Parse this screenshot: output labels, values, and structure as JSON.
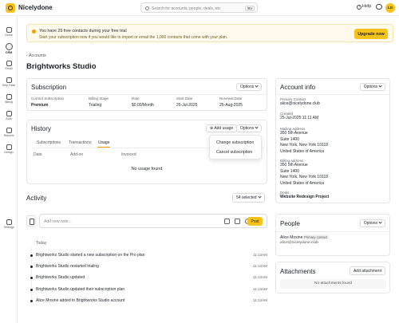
{
  "topbar": {
    "brand": "Nicelydone",
    "search_placeholder": "Search for accounts, people, deals, etc",
    "search_shortcut": "⌘K",
    "help_label": "Help",
    "avatar_initials": "LG"
  },
  "nav": [
    {
      "label": "Home",
      "icon": "home-icon"
    },
    {
      "label": "CRM",
      "icon": "crm-icon",
      "active": true
    },
    {
      "label": "Email",
      "icon": "email-icon"
    },
    {
      "label": "Help Desk",
      "icon": "help-desk-icon"
    },
    {
      "label": "Billing",
      "icon": "billing-icon"
    },
    {
      "label": "Auth",
      "icon": "auth-icon"
    },
    {
      "label": "Reports",
      "icon": "reports-icon"
    },
    {
      "label": "Design",
      "icon": "design-icon"
    },
    {
      "label": "Settings",
      "icon": "settings-icon"
    }
  ],
  "banner": {
    "title": "You have 25 free contacts during your free trial",
    "subtitle": "Start your subscription now if you would like to import or email the 1,000 contacts that come with your plan.",
    "cta": "Upgrade now"
  },
  "breadcrumb": "Accounts",
  "page_title": "Brightworks Studio",
  "subscription": {
    "title": "Subscription",
    "options_label": "Options",
    "fields": [
      {
        "label": "Current Subscription",
        "value": "Premium",
        "bold": true
      },
      {
        "label": "Billing Stage",
        "value": "Trialing"
      },
      {
        "label": "Rate",
        "value": "$0.00/Month"
      },
      {
        "label": "Start Date",
        "value": "25-Jul-2025"
      },
      {
        "label": "Renewal Date",
        "value": "25-Aug-2025"
      }
    ]
  },
  "history": {
    "title": "History",
    "add_usage_label": "Add usage",
    "options_label": "Options",
    "tabs": [
      "Subscriptions",
      "Transactions",
      "Usage"
    ],
    "active_tab": "Usage",
    "columns": [
      "Date",
      "Add-on",
      "Invoiced"
    ],
    "empty_text": "No usage found"
  },
  "options_menu": [
    "Change subscription",
    "Cancel subscription"
  ],
  "activity": {
    "title": "Activity",
    "filter_label": "54 selected",
    "note_placeholder": "Add new note...",
    "post_label": "Post",
    "day_label": "Today",
    "items": [
      {
        "text": "Brightworks Studio started a new subscription on the Pro plan",
        "time": "11:13AM"
      },
      {
        "text": "Brightworks Studio restarted trialing",
        "time": "11:13AM"
      },
      {
        "text": "Brightworks Studio updated",
        "time": "11:13AM"
      },
      {
        "text": "Brightworks Studio updated their subscription plan",
        "time": "11:13AM"
      },
      {
        "text": "Alice Moxine added to Brightworks Studio account",
        "time": "11:13AM"
      }
    ]
  },
  "account_info": {
    "title": "Account info",
    "options_label": "Options",
    "primary_contact_label": "Primary Contact",
    "primary_contact": "alice@nicelydone.club",
    "created_label": "Created",
    "created": "25-Jul-2025 11:11 AM",
    "mailing_label": "Mailing address",
    "mailing": [
      "350 5th Avenue",
      "Suite 1400",
      "New York, New York  10118",
      "United States of America"
    ],
    "billing_label": "Billing address",
    "billing": [
      "350 5th Avenue",
      "Suite 1400",
      "New York, New York  10118",
      "United States of America"
    ],
    "deals_label": "Deals",
    "deal": "Website Redesign Project"
  },
  "people": {
    "title": "People",
    "options_label": "Options",
    "name": "Alice Moxine",
    "badge": "Primary contact",
    "email": "alice@nicelydone.club"
  },
  "attachments": {
    "title": "Attachments",
    "add_label": "Add attachment",
    "empty_text": "No attachments found"
  }
}
